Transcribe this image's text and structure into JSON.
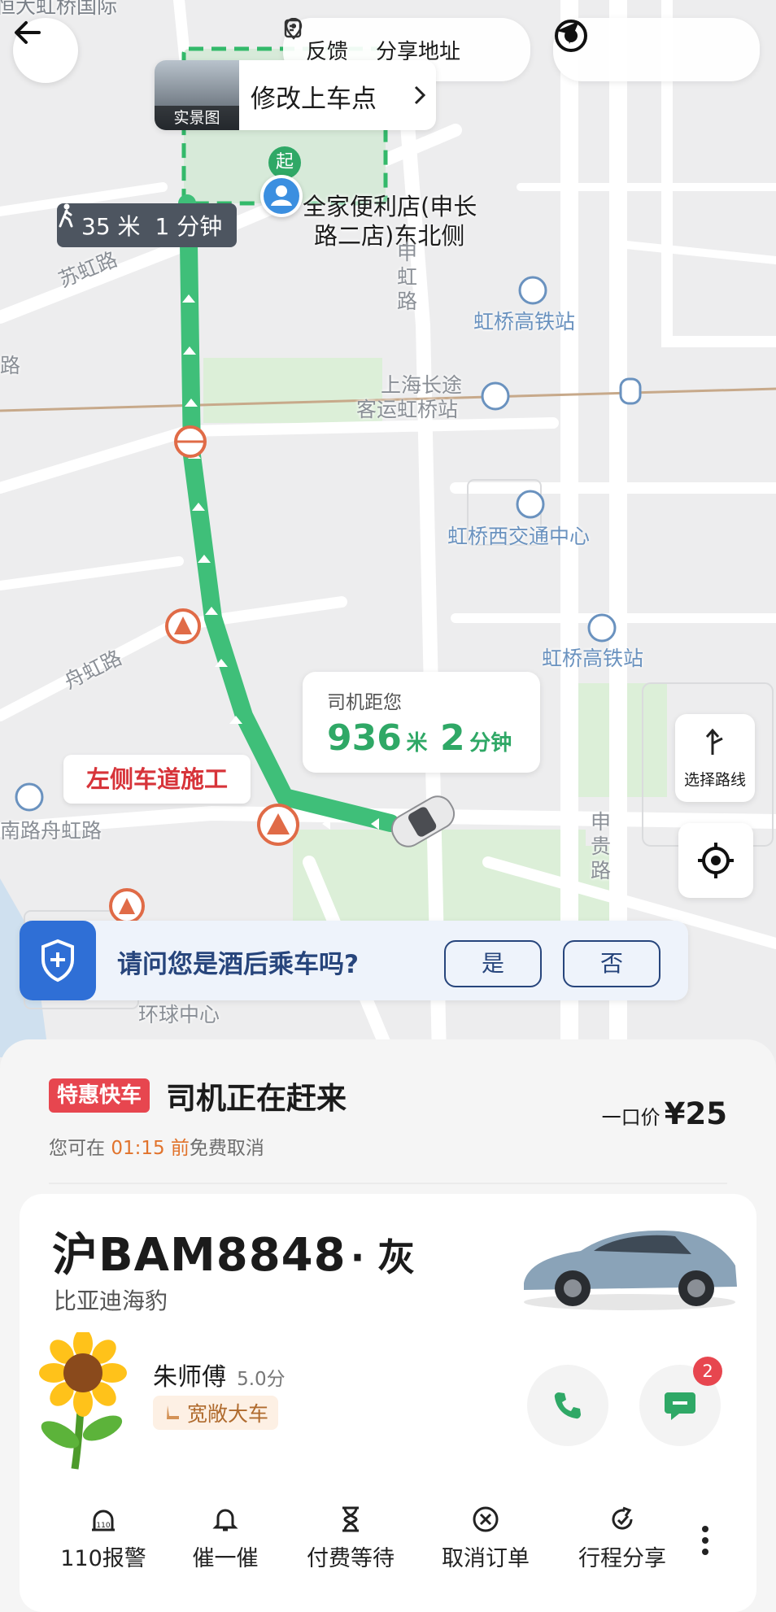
{
  "header": {
    "feedback_label": "反馈",
    "share_address_label": "分享地址",
    "cut_label": "恒大虹桥国际"
  },
  "pickup": {
    "live_view_badge": "实景图",
    "modify_label": "修改上车点",
    "place_name_line1": "全家便利店(申长",
    "place_name_line2": "路二店)东北侧",
    "start_marker": "起",
    "walk_distance": "35 米",
    "walk_time": "1 分钟"
  },
  "map": {
    "roads": {
      "suhong": "苏虹路",
      "lu_left": "路",
      "shenhong": "申虹路",
      "zhouhong": "舟虹路",
      "nanlu_zhouhong": "南路舟虹路",
      "shengui": "申贵路",
      "huanqiu": "环球中心"
    },
    "pois": {
      "hongqiao_hsr_1": "虹桥高铁站",
      "coach_line1": "上海长途",
      "coach_line2": "客运虹桥站",
      "west_transport": "虹桥西交通中心",
      "hongqiao_hsr_2": "虹桥高铁站"
    },
    "construction_warning": "左侧车道施工",
    "select_route_label": "选择路线"
  },
  "driver_distance": {
    "label": "司机距您",
    "distance_value": "936",
    "distance_unit": "米",
    "time_value": "2",
    "time_unit": "分钟"
  },
  "drunk_prompt": {
    "question": "请问您是酒后乘车吗?",
    "yes_label": "是",
    "no_label": "否"
  },
  "status": {
    "service_badge": "特惠快车",
    "title": "司机正在赶来",
    "cancel_prefix": "您可在 ",
    "cancel_time": "01:15 前",
    "cancel_suffix": "免费取消",
    "price_label": "一口价",
    "price_value": "¥25"
  },
  "vehicle": {
    "plate": "沪BAM8848",
    "color": "· 灰",
    "model": "比亚迪海豹"
  },
  "driver": {
    "name": "朱师傅",
    "rating": "5.0分",
    "tag": "宽敞大车",
    "message_badge": "2"
  },
  "actions": [
    {
      "label": "110报警",
      "icon": "police-icon"
    },
    {
      "label": "催一催",
      "icon": "bell-icon"
    },
    {
      "label": "付费等待",
      "icon": "hourglass-icon"
    },
    {
      "label": "取消订单",
      "icon": "cancel-circle-icon"
    },
    {
      "label": "行程分享",
      "icon": "share-icon"
    }
  ],
  "colors": {
    "route_green": "#3fbf79",
    "accent_green": "#2fa866",
    "badge_red": "#e7464f",
    "warning_red": "#d7343a",
    "prompt_blue": "#2f6fd6",
    "cancel_orange": "#e1732c"
  }
}
